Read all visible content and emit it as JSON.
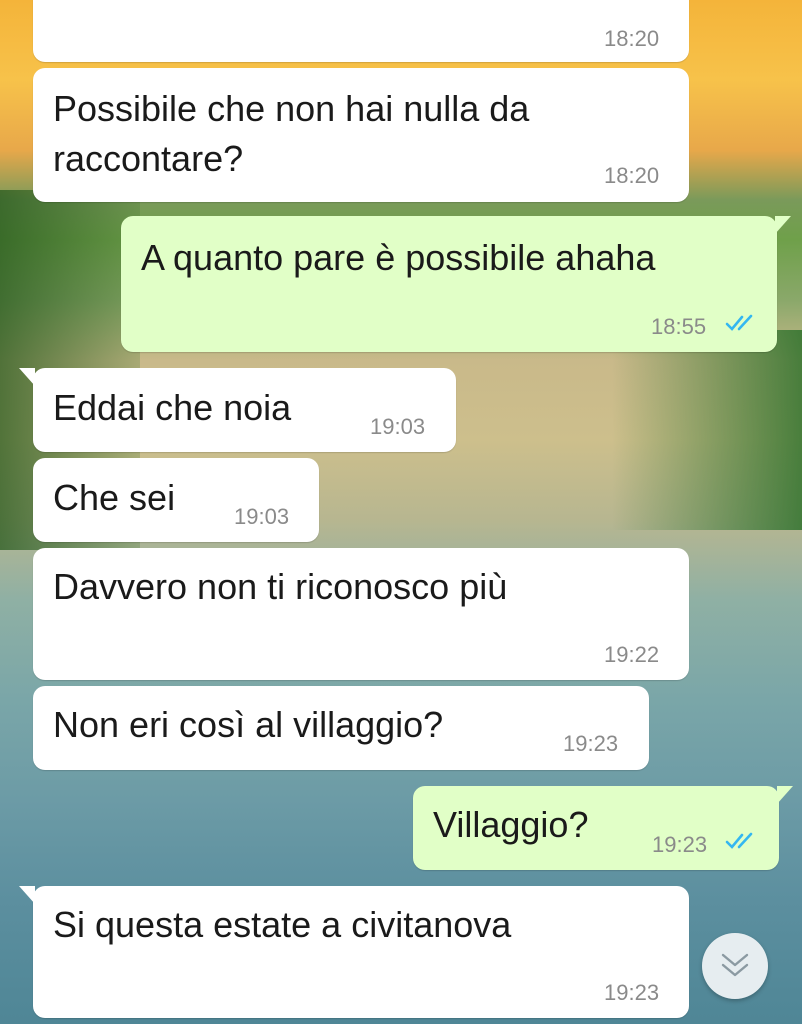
{
  "messages": [
    {
      "direction": "in",
      "text": "",
      "time": "18:20"
    },
    {
      "direction": "in",
      "text": "Possibile che non hai nulla da\nraccontare?",
      "time": "18:20"
    },
    {
      "direction": "out",
      "text": "A quanto pare è possibile ahaha",
      "time": "18:55",
      "status": "read"
    },
    {
      "direction": "in",
      "text": "Eddai che noia",
      "time": "19:03"
    },
    {
      "direction": "in",
      "text": "Che sei",
      "time": "19:03"
    },
    {
      "direction": "in",
      "text": "Davvero non ti riconosco più",
      "time": "19:22"
    },
    {
      "direction": "in",
      "text": "Non eri così al villaggio?",
      "time": "19:23"
    },
    {
      "direction": "out",
      "text": "Villaggio?",
      "time": "19:23",
      "status": "read"
    },
    {
      "direction": "in",
      "text": "Si questa estate a civitanova",
      "time": "19:23"
    }
  ],
  "scroll_button": {
    "icon": "double-chevron-down-icon"
  },
  "colors": {
    "incoming_bubble": "#ffffff",
    "outgoing_bubble": "#e1ffc7",
    "read_check": "#34b7f1",
    "timestamp": "#8a8a8a"
  }
}
